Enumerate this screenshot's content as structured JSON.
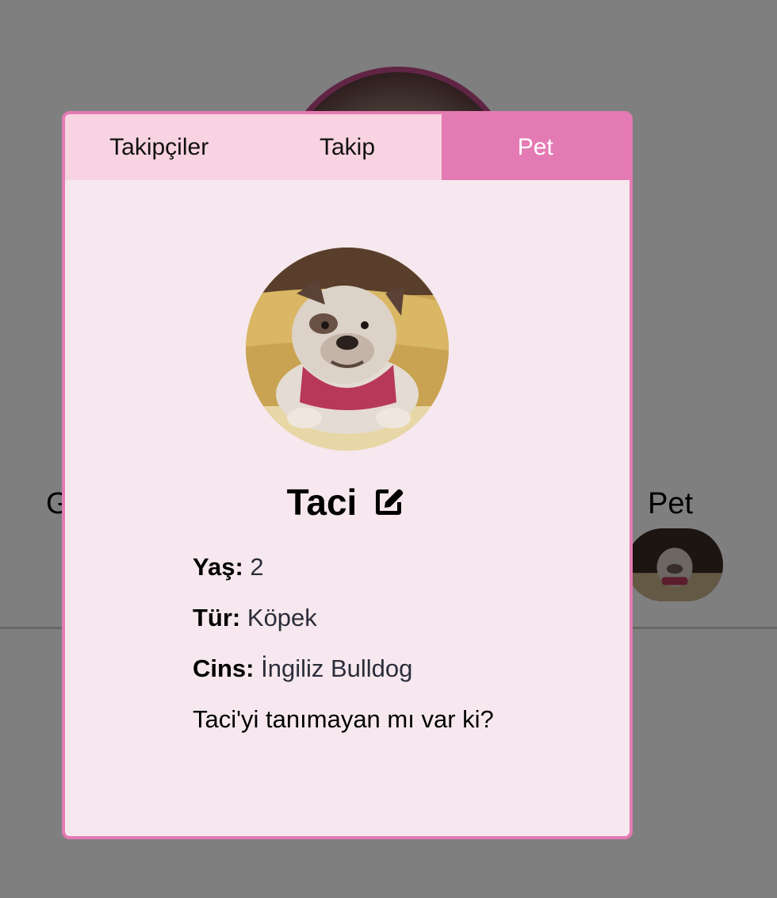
{
  "tabs": [
    {
      "label": "Takipçiler",
      "active": false
    },
    {
      "label": "Takip",
      "active": false
    },
    {
      "label": "Pet",
      "active": true
    }
  ],
  "background": {
    "left_label": "G",
    "pet_label": "Pet"
  },
  "pet": {
    "name": "Taci",
    "age_label": "Yaş:",
    "age": "2",
    "type_label": "Tür:",
    "type": "Köpek",
    "breed_label": "Cins:",
    "breed": "İngiliz Bulldog",
    "description": "Taci'yi tanımayan mı var ki?"
  },
  "icons": {
    "edit": "edit-pencil-square-icon"
  },
  "colors": {
    "accent": "#e47ab3",
    "tab_inactive": "#f8d3e1",
    "modal_bg": "#f6e8ee",
    "overlay": "rgba(0,0,0,0.5)"
  }
}
